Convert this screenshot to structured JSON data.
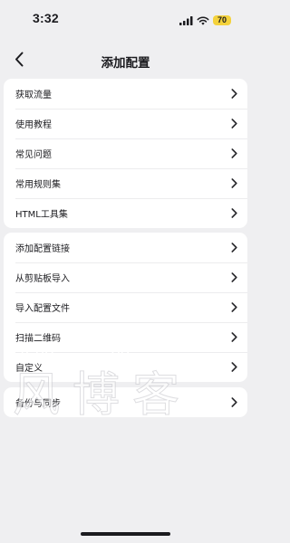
{
  "status_bar": {
    "time": "3:32",
    "battery": "70",
    "icons": [
      "signal-icon",
      "wifi-icon",
      "battery-icon"
    ]
  },
  "nav": {
    "title": "添加配置",
    "back_icon": "chevron-left-icon"
  },
  "groups": [
    {
      "items": [
        {
          "label": "获取流量"
        },
        {
          "label": "使用教程"
        },
        {
          "label": "常见问题"
        },
        {
          "label": "常用规则集"
        },
        {
          "label": "HTML工具集"
        }
      ]
    },
    {
      "items": [
        {
          "label": "添加配置链接"
        },
        {
          "label": "从剪贴板导入"
        },
        {
          "label": "导入配置文件"
        },
        {
          "label": "扫描二维码"
        },
        {
          "label": "自定义"
        }
      ]
    },
    {
      "items": [
        {
          "label": "备份与同步"
        }
      ]
    }
  ],
  "watermark": {
    "pinyin": [
      "fēng",
      "bó",
      "kè"
    ],
    "characters": "风博客"
  },
  "colors": {
    "background": "#efeff1",
    "card": "#ffffff",
    "text": "#1b1b1f",
    "battery_badge": "#f4d23c"
  }
}
